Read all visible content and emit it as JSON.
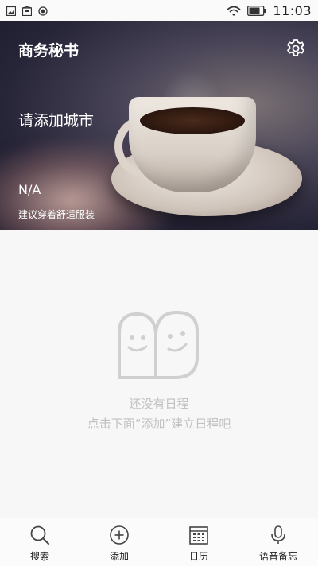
{
  "statusbar": {
    "time": "11:03",
    "icons": [
      "gallery-icon",
      "package-icon",
      "record-icon",
      "wifi-icon",
      "battery-icon"
    ]
  },
  "header": {
    "title": "商务秘书",
    "city_prompt": "请添加城市",
    "temperature": "N/A",
    "advice": "建议穿着舒适服装",
    "settings_icon": "gear-icon"
  },
  "empty_state": {
    "line1": "还没有日程",
    "line2": "点击下面“添加”建立日程吧"
  },
  "bottom_nav": {
    "items": [
      {
        "label": "搜索",
        "icon": "search-icon"
      },
      {
        "label": "添加",
        "icon": "add-icon"
      },
      {
        "label": "日历",
        "icon": "calendar-icon"
      },
      {
        "label": "语音备忘",
        "icon": "microphone-icon"
      }
    ]
  }
}
